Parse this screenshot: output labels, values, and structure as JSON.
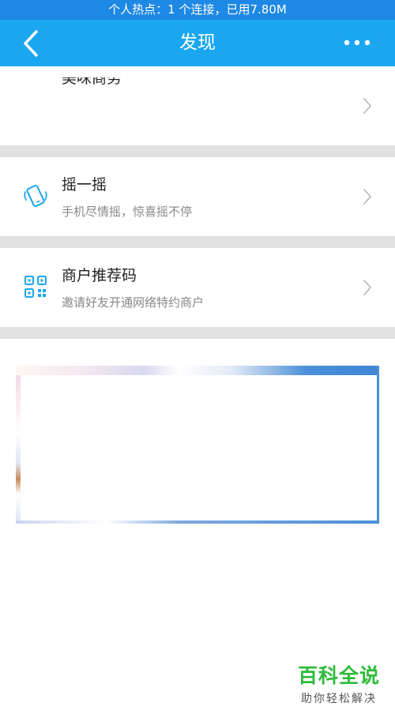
{
  "status_bar": {
    "text": "个人热点：1 个连接，已用7.80M"
  },
  "header": {
    "title": "发现"
  },
  "partial_item": {
    "title": "美味商务"
  },
  "items": [
    {
      "title": "摇一摇",
      "subtitle": "手机尽情摇，惊喜摇不停",
      "icon": "shake-phone-icon"
    },
    {
      "title": "商户推荐码",
      "subtitle": "邀请好友开通网络特约商户",
      "icon": "qr-code-icon"
    }
  ],
  "watermark": {
    "title": "百科全说",
    "subtitle": "助你轻松解决"
  },
  "colors": {
    "header": "#1aa7ef",
    "status_bar": "#1e88e5",
    "icon_accent": "#1aa7ef",
    "watermark": "#2dbb3a"
  }
}
